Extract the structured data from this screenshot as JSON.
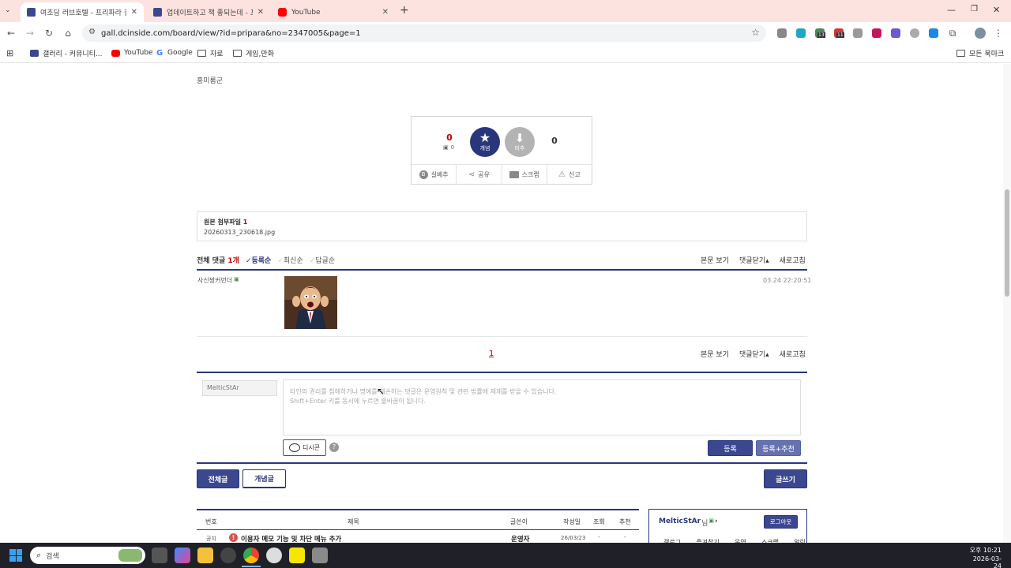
{
  "browser": {
    "tabs": [
      {
        "title": "여조딩 러브호텔 - 프리파라 갤",
        "active": true,
        "icon": "dcinside-icon"
      },
      {
        "title": "업데이트하고 책 좋되는데 - 프",
        "active": false,
        "icon": "dcinside-icon"
      },
      {
        "title": "YouTube",
        "active": false,
        "icon": "youtube-icon"
      }
    ],
    "new_tab": "+",
    "url": "gall.dcinside.com/board/view/?id=pripara&no=2347005&page=1",
    "bookmarks": [
      {
        "label": "갤러리 - 커뮤니티...",
        "icon": "dcinside-icon"
      },
      {
        "label": "YouTube",
        "icon": "youtube-icon"
      },
      {
        "label": "Google",
        "icon": "google-icon"
      },
      {
        "label": "자료",
        "icon": "folder-icon"
      },
      {
        "label": "게임,만화",
        "icon": "folder-icon"
      }
    ],
    "all_bookmarks": "모든 북마크",
    "ext_badges": [
      "13",
      "11"
    ]
  },
  "post": {
    "author_name": "홍미룸군",
    "vote": {
      "recommend_count": "0",
      "fixed_recommend": "0",
      "recommend_label": "개념",
      "dislike_label": "비추",
      "dislike_count": "0",
      "actions": [
        "실베추",
        "공유",
        "스크랩",
        "신고"
      ]
    },
    "attachments": {
      "label": "원본 첨부파일",
      "count": "1",
      "files": [
        "20260313_230618.jpg"
      ]
    }
  },
  "comments": {
    "total_label": "전체 댓글",
    "total_count": "1개",
    "sorts": [
      "등록순",
      "최신순",
      "답글순"
    ],
    "view_post": "본문 보기",
    "fold_comments": "댓글닫기",
    "refresh": "새로고침",
    "list": [
      {
        "nick": "사신짱커먼더",
        "time": "03.24 22:20:51",
        "content": "image"
      }
    ],
    "pagination": [
      "1"
    ],
    "form": {
      "nickname": "MelticStAr",
      "placeholder_line1": "타인의 권리를 침해하거나 명예를 훼손하는 댓글은 운영원칙 및 관련 법률에 제재를 받을 수 있습니다.",
      "placeholder_line2": "Shift+Enter 키를 동시에 누르면 줄바꿈이 됩니다.",
      "dccon_label": "디시콘",
      "help": "?",
      "submit": "등록",
      "submit_recommend": "등록+추천"
    }
  },
  "board_buttons": {
    "all": "전체글",
    "concept": "개념글",
    "write": "글쓰기"
  },
  "list": {
    "headers": [
      "번호",
      "제목",
      "글쓴이",
      "작성일",
      "조회",
      "추천"
    ],
    "rows": [
      {
        "no": "공지",
        "title": "이용자 메모 기능 및 차단 메뉴 추가",
        "writer": "운영자",
        "date": "26/03/23",
        "views": "-",
        "recs": "-"
      }
    ]
  },
  "side": {
    "user": "MelticStAr",
    "user_suffix": "님",
    "logout": "로그아웃",
    "menu": [
      "갤로그",
      "즐겨찾기",
      "운영",
      "스크랩",
      "알림"
    ]
  },
  "taskbar": {
    "search": "검색",
    "time": "오후 10:21",
    "date": "2026-03-24"
  },
  "colors": {
    "navy": "#3b4890",
    "tab_strip": "#fde3df",
    "recommend": "#29367c",
    "count_red": "#c00000"
  }
}
